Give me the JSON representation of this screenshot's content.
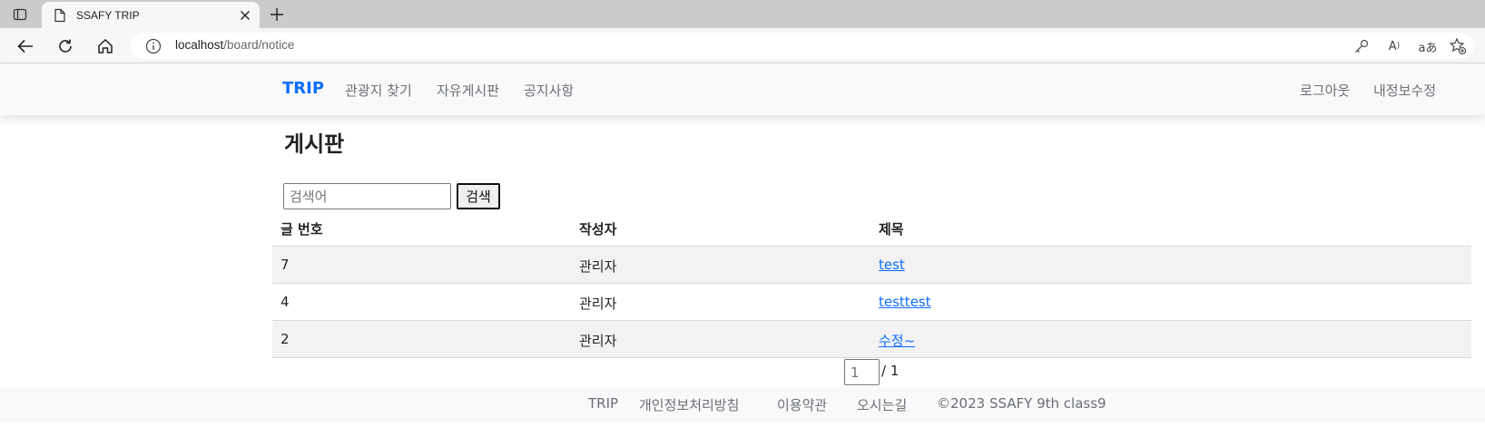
{
  "browser": {
    "tab_title": "SSAFY TRIP",
    "url_host": "localhost",
    "url_path": "/board/notice",
    "icons": [
      "sidebar-toggle-icon",
      "document-icon",
      "close-icon",
      "plus-icon",
      "back-icon",
      "reload-icon",
      "home-icon",
      "info-icon",
      "key-icon",
      "read-aloud-icon",
      "translate-icon",
      "favorite-add-icon"
    ],
    "read_aloud_glyph": "A",
    "translate_glyph": "aあ"
  },
  "navbar": {
    "brand": "TRIP",
    "links": [
      "관광지 찾기",
      "자유게시판",
      "공지사항"
    ],
    "right_links": [
      "로그아웃",
      "내정보수정"
    ],
    "brand_color": "#0d6efd"
  },
  "board": {
    "title": "게시판",
    "search_placeholder": "검색어",
    "search_button": "검색",
    "columns": [
      "글 번호",
      "작성자",
      "제목"
    ],
    "rows": [
      {
        "no": "7",
        "author": "관리자",
        "title": "test"
      },
      {
        "no": "4",
        "author": "관리자",
        "title": "testtest"
      },
      {
        "no": "2",
        "author": "관리자",
        "title": "수정~"
      }
    ],
    "page_placeholder": "1",
    "page_total": "/ 1"
  },
  "footer": {
    "links": [
      "TRIP",
      "개인정보처리방침",
      "이용약관",
      "오시는길"
    ],
    "copyright": "©2023 SSAFY 9th class9"
  }
}
